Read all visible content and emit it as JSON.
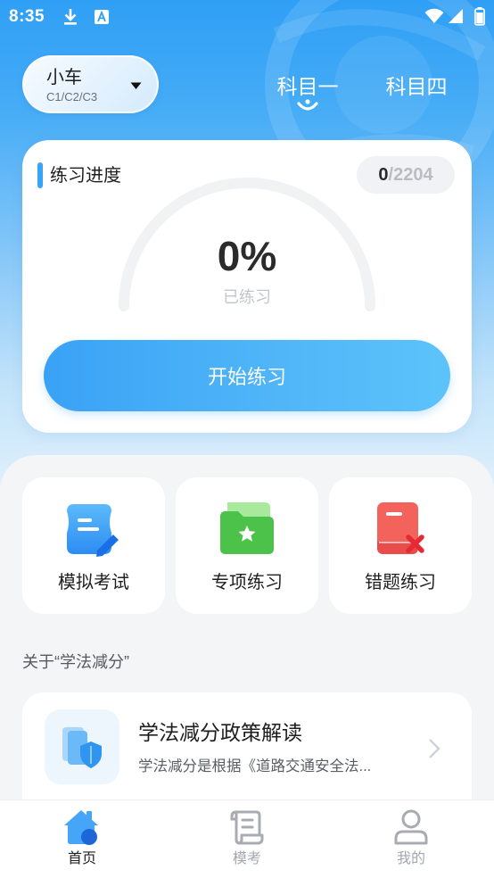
{
  "status_bar": {
    "time": "8:35",
    "icons": [
      "download-icon",
      "keyboard-a-icon",
      "wifi-icon",
      "signal-icon",
      "battery-icon"
    ]
  },
  "vehicle": {
    "name": "小车",
    "licenses": "C1/C2/C3"
  },
  "subject_tabs": [
    {
      "label": "科目一",
      "selected": true
    },
    {
      "label": "科目四",
      "selected": false
    }
  ],
  "progress": {
    "title": "练习进度",
    "done": "0",
    "total": "/2204",
    "percent": "0%",
    "percent_value": 0,
    "caption": "已练习",
    "start_button": "开始练习"
  },
  "features": [
    {
      "label": "模拟考试",
      "icon": "mock-exam-icon"
    },
    {
      "label": "专项练习",
      "icon": "topic-folder-icon"
    },
    {
      "label": "错题练习",
      "icon": "wrong-book-icon"
    }
  ],
  "about": {
    "section_title": "关于“学法减分”",
    "card": {
      "title": "学法减分政策解读",
      "subtitle": "学法减分是根据《道路交通安全法...",
      "icon": "policy-shield-icon"
    }
  },
  "bottom_nav": [
    {
      "label": "首页",
      "icon": "home-icon",
      "active": true
    },
    {
      "label": "模考",
      "icon": "exam-scroll-icon",
      "active": false
    },
    {
      "label": "我的",
      "icon": "user-icon",
      "active": false
    }
  ],
  "colors": {
    "accent": "#3aa3f5",
    "gauge_track": "#f1f2f4",
    "gauge_fill": "#3aa3f5",
    "page_bg": "#f4f5f7",
    "card_bg": "#ffffff",
    "nav_inactive": "#a3a7ad"
  }
}
